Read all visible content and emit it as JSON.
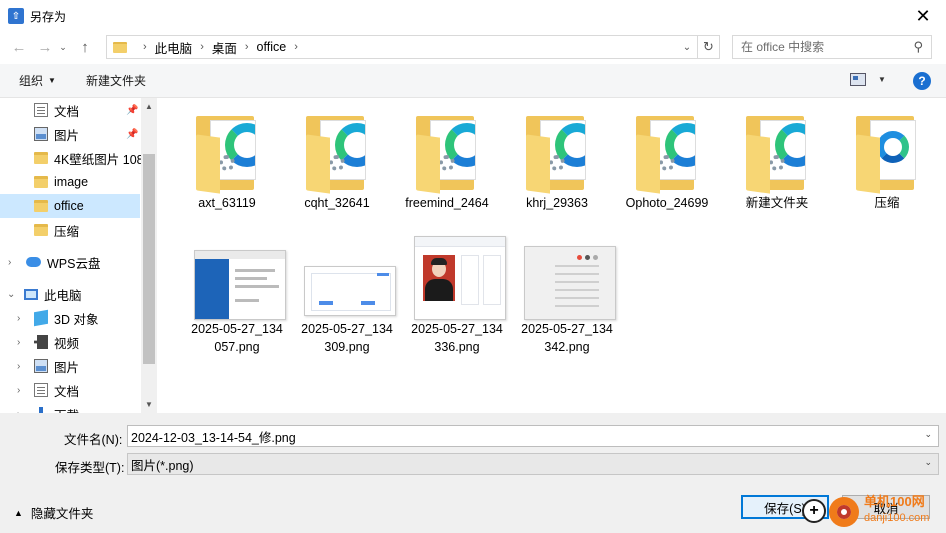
{
  "window": {
    "title": "另存为",
    "app_icon": "save-dialog-icon"
  },
  "address": {
    "crumbs": [
      "此电脑",
      "桌面",
      "office"
    ],
    "search_placeholder": "在 office 中搜索"
  },
  "toolbar": {
    "organize": "组织",
    "new_folder": "新建文件夹"
  },
  "nav": {
    "items": [
      {
        "label": "文档",
        "icon": "document-icon",
        "pinned": true
      },
      {
        "label": "图片",
        "icon": "pictures-icon",
        "pinned": true
      },
      {
        "label": "4K壁纸图片 108",
        "icon": "folder-icon"
      },
      {
        "label": "image",
        "icon": "folder-icon"
      },
      {
        "label": "office",
        "icon": "folder-icon",
        "selected": true
      },
      {
        "label": "压缩",
        "icon": "folder-icon"
      },
      {
        "label": "WPS云盘",
        "icon": "cloud-icon"
      },
      {
        "label": "此电脑",
        "icon": "computer-icon"
      },
      {
        "label": "3D 对象",
        "icon": "3d-objects-icon"
      },
      {
        "label": "视频",
        "icon": "video-icon"
      },
      {
        "label": "图片",
        "icon": "pictures-icon"
      },
      {
        "label": "文档",
        "icon": "document-icon"
      },
      {
        "label": "下载",
        "icon": "download-icon"
      }
    ]
  },
  "files": {
    "folders": [
      "axt_63119",
      "cqht_32641",
      "freemind_2464",
      "khrj_29363",
      "Ophoto_24699",
      "新建文件夹",
      "压缩"
    ],
    "images": [
      {
        "line1": "2025-05-27_134",
        "line2": "057.png"
      },
      {
        "line1": "2025-05-27_134",
        "line2": "309.png"
      },
      {
        "line1": "2025-05-27_134",
        "line2": "336.png"
      },
      {
        "line1": "2025-05-27_134",
        "line2": "342.png"
      }
    ]
  },
  "form": {
    "filename_label": "文件名(N):",
    "filename_value": "2024-12-03_13-14-54_修.png",
    "filetype_label": "保存类型(T):",
    "filetype_value": "图片(*.png)"
  },
  "footer": {
    "hide_folders": "隐藏文件夹",
    "save": "保存(S)",
    "cancel": "取消"
  },
  "watermark": {
    "site": "单机100网",
    "url": "danji100.com"
  },
  "colors": {
    "accent": "#0078d7",
    "selected": "#cce8ff",
    "folder": "#f0c55a",
    "watermark": "#f07b1a"
  }
}
